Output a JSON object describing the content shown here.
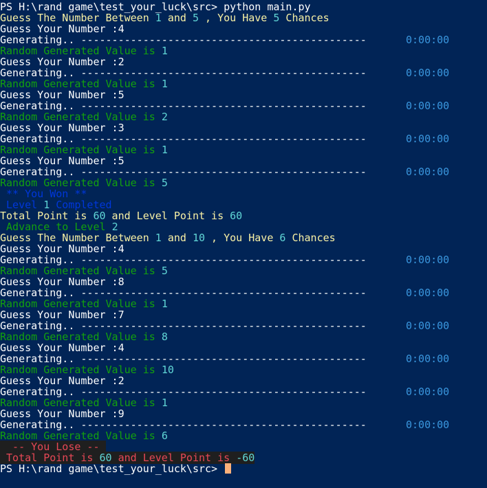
{
  "colors": {
    "background": "#012456",
    "white": "#ffffff",
    "yellow": "#f9f1a5",
    "cyan": "#61d6d6",
    "green": "#13a10e",
    "blue": "#0037da",
    "timer": "#3a96dd",
    "red": "#e74856",
    "lose_bg": "#1f1f1f",
    "cursor": "#fcb07a"
  },
  "terminal": {
    "lines": [
      {
        "segments": [
          {
            "text": "PS H:\\rand game\\test_your_luck\\src> python main.py",
            "color": "white"
          }
        ]
      },
      {
        "segments": [
          {
            "text": "Guess The Number Between ",
            "color": "yellow"
          },
          {
            "text": "1",
            "color": "cyan"
          },
          {
            "text": " and ",
            "color": "yellow"
          },
          {
            "text": "5",
            "color": "cyan"
          },
          {
            "text": " , You Have ",
            "color": "yellow"
          },
          {
            "text": "5",
            "color": "cyan"
          },
          {
            "text": " Chances",
            "color": "yellow"
          }
        ]
      },
      {
        "segments": [
          {
            "text": "Guess Your Number :4",
            "color": "white"
          }
        ]
      },
      {
        "segments": [
          {
            "text": "Generating.. ----------------------------------------------",
            "color": "white"
          }
        ],
        "timer": "0:00:00"
      },
      {
        "segments": [
          {
            "text": "Random Generated Value is ",
            "color": "green"
          },
          {
            "text": "1",
            "color": "cyan"
          }
        ]
      },
      {
        "segments": [
          {
            "text": "Guess Your Number :2",
            "color": "white"
          }
        ]
      },
      {
        "segments": [
          {
            "text": "Generating.. ----------------------------------------------",
            "color": "white"
          }
        ],
        "timer": "0:00:00"
      },
      {
        "segments": [
          {
            "text": "Random Generated Value is ",
            "color": "green"
          },
          {
            "text": "1",
            "color": "cyan"
          }
        ]
      },
      {
        "segments": [
          {
            "text": "Guess Your Number :5",
            "color": "white"
          }
        ]
      },
      {
        "segments": [
          {
            "text": "Generating.. ----------------------------------------------",
            "color": "white"
          }
        ],
        "timer": "0:00:00"
      },
      {
        "segments": [
          {
            "text": "Random Generated Value is ",
            "color": "green"
          },
          {
            "text": "2",
            "color": "cyan"
          }
        ]
      },
      {
        "segments": [
          {
            "text": "Guess Your Number :3",
            "color": "white"
          }
        ]
      },
      {
        "segments": [
          {
            "text": "Generating.. ----------------------------------------------",
            "color": "white"
          }
        ],
        "timer": "0:00:00"
      },
      {
        "segments": [
          {
            "text": "Random Generated Value is ",
            "color": "green"
          },
          {
            "text": "1",
            "color": "cyan"
          }
        ]
      },
      {
        "segments": [
          {
            "text": "Guess Your Number :5",
            "color": "white"
          }
        ]
      },
      {
        "segments": [
          {
            "text": "Generating.. ----------------------------------------------",
            "color": "white"
          }
        ],
        "timer": "0:00:00"
      },
      {
        "segments": [
          {
            "text": "Random Generated Value is ",
            "color": "green"
          },
          {
            "text": "5",
            "color": "cyan"
          }
        ]
      },
      {
        "segments": [
          {
            "text": " ** You Won **",
            "color": "blue"
          }
        ]
      },
      {
        "segments": [
          {
            "text": " Level ",
            "color": "blue"
          },
          {
            "text": "1",
            "color": "cyan"
          },
          {
            "text": " Completed",
            "color": "blue"
          }
        ]
      },
      {
        "segments": [
          {
            "text": "Total Point is ",
            "color": "yellow"
          },
          {
            "text": "60",
            "color": "cyan"
          },
          {
            "text": " and Level Point is ",
            "color": "yellow"
          },
          {
            "text": "60",
            "color": "cyan"
          }
        ]
      },
      {
        "segments": [
          {
            "text": " Advance to Level ",
            "color": "green"
          },
          {
            "text": "2",
            "color": "cyan"
          }
        ]
      },
      {
        "segments": [
          {
            "text": "Guess The Number Between ",
            "color": "yellow"
          },
          {
            "text": "1",
            "color": "cyan"
          },
          {
            "text": " and ",
            "color": "yellow"
          },
          {
            "text": "10",
            "color": "cyan"
          },
          {
            "text": " , You Have ",
            "color": "yellow"
          },
          {
            "text": "6",
            "color": "cyan"
          },
          {
            "text": " Chances",
            "color": "yellow"
          }
        ]
      },
      {
        "segments": [
          {
            "text": "Guess Your Number :4",
            "color": "white"
          }
        ]
      },
      {
        "segments": [
          {
            "text": "Generating.. ----------------------------------------------",
            "color": "white"
          }
        ],
        "timer": "0:00:00"
      },
      {
        "segments": [
          {
            "text": "Random Generated Value is ",
            "color": "green"
          },
          {
            "text": "5",
            "color": "cyan"
          }
        ]
      },
      {
        "segments": [
          {
            "text": "Guess Your Number :8",
            "color": "white"
          }
        ]
      },
      {
        "segments": [
          {
            "text": "Generating.. ----------------------------------------------",
            "color": "white"
          }
        ],
        "timer": "0:00:00"
      },
      {
        "segments": [
          {
            "text": "Random Generated Value is ",
            "color": "green"
          },
          {
            "text": "1",
            "color": "cyan"
          }
        ]
      },
      {
        "segments": [
          {
            "text": "Guess Your Number :7",
            "color": "white"
          }
        ]
      },
      {
        "segments": [
          {
            "text": "Generating.. ----------------------------------------------",
            "color": "white"
          }
        ],
        "timer": "0:00:00"
      },
      {
        "segments": [
          {
            "text": "Random Generated Value is ",
            "color": "green"
          },
          {
            "text": "8",
            "color": "cyan"
          }
        ]
      },
      {
        "segments": [
          {
            "text": "Guess Your Number :4",
            "color": "white"
          }
        ]
      },
      {
        "segments": [
          {
            "text": "Generating.. ----------------------------------------------",
            "color": "white"
          }
        ],
        "timer": "0:00:00"
      },
      {
        "segments": [
          {
            "text": "Random Generated Value is ",
            "color": "green"
          },
          {
            "text": "10",
            "color": "cyan"
          }
        ]
      },
      {
        "segments": [
          {
            "text": "Guess Your Number :2",
            "color": "white"
          }
        ]
      },
      {
        "segments": [
          {
            "text": "Generating.. ----------------------------------------------",
            "color": "white"
          }
        ],
        "timer": "0:00:00"
      },
      {
        "segments": [
          {
            "text": "Random Generated Value is ",
            "color": "green"
          },
          {
            "text": "1",
            "color": "cyan"
          }
        ]
      },
      {
        "segments": [
          {
            "text": "Guess Your Number :9",
            "color": "white"
          }
        ]
      },
      {
        "segments": [
          {
            "text": "Generating.. ----------------------------------------------",
            "color": "white"
          }
        ],
        "timer": "0:00:00"
      },
      {
        "segments": [
          {
            "text": "Random Generated Value is ",
            "color": "green"
          },
          {
            "text": "6",
            "color": "cyan"
          }
        ]
      },
      {
        "segments": [
          {
            "text": "  -- You Lose -- ",
            "color": "red",
            "bg": "lose_bg"
          }
        ]
      },
      {
        "segments": [
          {
            "text": " Total Point is ",
            "color": "red",
            "bg": "lose_bg"
          },
          {
            "text": "60",
            "color": "cyan",
            "bg": "lose_bg"
          },
          {
            "text": " and Level Point is ",
            "color": "red",
            "bg": "lose_bg"
          },
          {
            "text": "-60",
            "color": "cyan",
            "bg": "lose_bg"
          }
        ]
      },
      {
        "segments": [
          {
            "text": "PS H:\\rand game\\test_your_luck\\src> ",
            "color": "white"
          }
        ],
        "cursor": true
      }
    ]
  }
}
